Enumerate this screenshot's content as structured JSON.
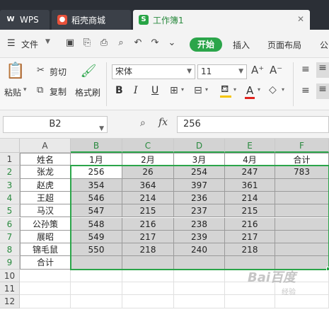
{
  "tabs": {
    "wps": "WPS",
    "store": "稻壳商城",
    "book": "工作簿1"
  },
  "menu": {
    "file": "文件",
    "start": "开始",
    "insert": "插入",
    "layout": "页面布局",
    "formula_trunc": "公"
  },
  "ribbon": {
    "paste": "粘贴",
    "cut": "剪切",
    "copy": "复制",
    "format_painter": "格式刷",
    "font_name": "宋体",
    "font_size": "11",
    "bold": "B",
    "italic": "I",
    "underline": "U",
    "font_color_letter": "A"
  },
  "formula_bar": {
    "cell_ref": "B2",
    "fx": "fx",
    "value": "256"
  },
  "sheet": {
    "columns": [
      "A",
      "B",
      "C",
      "D",
      "E",
      "F"
    ],
    "rows": [
      "1",
      "2",
      "3",
      "4",
      "5",
      "6",
      "7",
      "8",
      "9",
      "10",
      "11",
      "12"
    ],
    "header": [
      "姓名",
      "1月",
      "2月",
      "3月",
      "4月",
      "合计"
    ],
    "data": [
      [
        "张龙",
        "256",
        "26",
        "254",
        "247",
        "783"
      ],
      [
        "赵虎",
        "354",
        "364",
        "397",
        "361",
        ""
      ],
      [
        "王超",
        "546",
        "214",
        "236",
        "214",
        ""
      ],
      [
        "马汉",
        "547",
        "215",
        "237",
        "215",
        ""
      ],
      [
        "公孙策",
        "548",
        "216",
        "238",
        "216",
        ""
      ],
      [
        "展昭",
        "549",
        "217",
        "239",
        "217",
        ""
      ],
      [
        "锦毛鼠",
        "550",
        "218",
        "240",
        "218",
        ""
      ],
      [
        "合计",
        "",
        "",
        "",
        "",
        ""
      ]
    ]
  },
  "colors": {
    "accent": "#2ba54a",
    "selection_fill": "#d4d4d4",
    "tabbar_bg": "#2b2f36"
  },
  "watermark": {
    "main": "Bai百度",
    "sub": "经验"
  }
}
